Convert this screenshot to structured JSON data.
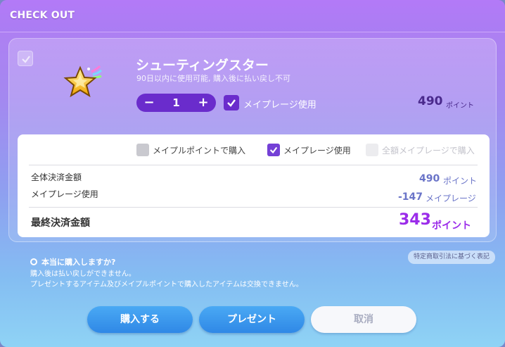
{
  "window": {
    "title": "CHECK OUT"
  },
  "item": {
    "name": "シューティングスター",
    "description": "90日以内に使用可能, 購入後に払い戻し不可",
    "icon": "star-icon",
    "quantity": "1",
    "minus_label": "−",
    "plus_label": "+",
    "mapleplay_label": "メイプレージ使用",
    "price": "490",
    "price_unit": "ポイント"
  },
  "payment_options": [
    {
      "label": "メイプルポイントで購入",
      "checked": false
    },
    {
      "label": "メイプレージ使用",
      "checked": true
    },
    {
      "label": "全額メイプレージで購入",
      "checked": false,
      "disabled": true
    }
  ],
  "summary": {
    "total_label": "全体決済金額",
    "total_value": "490",
    "total_unit": "ポイント",
    "mapleplay_label": "メイプレージ使用",
    "mapleplay_value": "-147",
    "mapleplay_unit": "メイプレージ",
    "final_label": "最終決済金額",
    "final_value": "343",
    "final_unit": "ポイント"
  },
  "legal_link": "特定商取引法に基づく表記",
  "confirm": {
    "question": "本当に購入しますか?",
    "note1": "購入後は払い戻しができません。",
    "note2": "プレゼントするアイテム及びメイプルポイントで購入したアイテムは交換できません。"
  },
  "buttons": {
    "purchase": "購入する",
    "present": "プレゼント",
    "cancel": "取消"
  },
  "colors": {
    "accent_purple": "#6a2ccc",
    "final_purple": "#9b2cea",
    "button_blue": "#2f88e6"
  }
}
